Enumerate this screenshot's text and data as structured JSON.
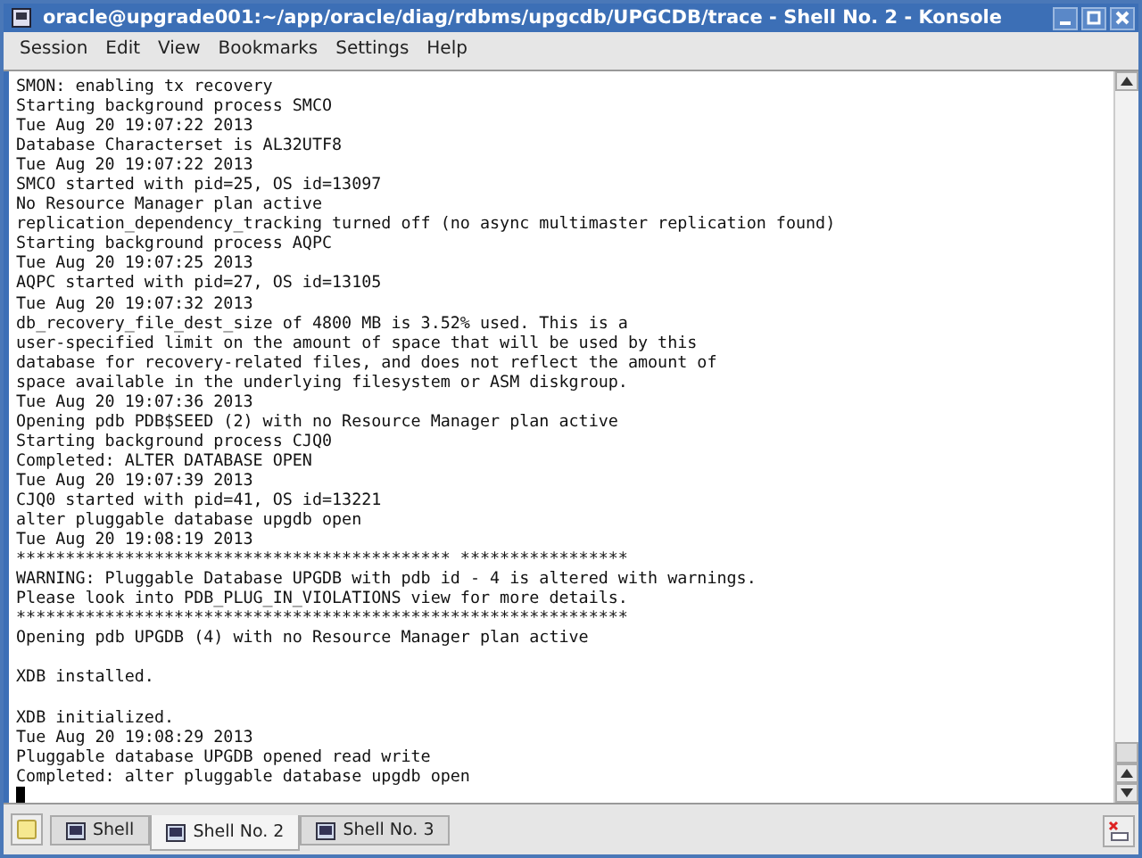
{
  "window": {
    "title": "oracle@upgrade001:~/app/oracle/diag/rdbms/upgcdb/UPGCDB/trace - Shell No. 2 - Konsole"
  },
  "menu": [
    "Session",
    "Edit",
    "View",
    "Bookmarks",
    "Settings",
    "Help"
  ],
  "terminal": {
    "lines": [
      {
        "kind": "text",
        "text": "SMON: enabling tx recovery"
      },
      {
        "kind": "text",
        "text": "Starting background process SMCO"
      },
      {
        "kind": "text",
        "text": "Tue Aug 20 19:07:22 2013"
      },
      {
        "kind": "text",
        "text": "Database Characterset is AL32UTF8"
      },
      {
        "kind": "text",
        "text": "Tue Aug 20 19:07:22 2013"
      },
      {
        "kind": "text",
        "text": "SMCO started with pid=25, OS id=13097"
      },
      {
        "kind": "text",
        "text": "No Resource Manager plan active"
      },
      {
        "kind": "text",
        "text": "replication_dependency_tracking turned off (no async multimaster replication found)"
      },
      {
        "kind": "text",
        "text": "Starting background process AQPC"
      },
      {
        "kind": "text",
        "text": "Tue Aug 20 19:07:25 2013"
      },
      {
        "kind": "text",
        "text": "AQPC started with pid=27, OS id=13105"
      },
      {
        "kind": "text",
        "text": "Tue Aug 20 19:07:32 2013"
      },
      {
        "kind": "text",
        "text": "db_recovery_file_dest_size of 4800 MB is 3.52% used. This is a"
      },
      {
        "kind": "text",
        "text": "user-specified limit on the amount of space that will be used by this"
      },
      {
        "kind": "text",
        "text": "database for recovery-related files, and does not reflect the amount of"
      },
      {
        "kind": "text",
        "text": "space available in the underlying filesystem or ASM diskgroup."
      },
      {
        "kind": "text",
        "text": "Tue Aug 20 19:07:36 2013"
      },
      {
        "kind": "text",
        "text": "Opening pdb PDB$SEED (2) with no Resource Manager plan active"
      },
      {
        "kind": "text",
        "text": "Starting background process CJQ0"
      },
      {
        "kind": "text",
        "text": "Completed: ALTER DATABASE OPEN"
      },
      {
        "kind": "text",
        "text": "Tue Aug 20 19:07:39 2013"
      },
      {
        "kind": "text",
        "text": "CJQ0 started with pid=41, OS id=13221"
      },
      {
        "kind": "text",
        "text": "alter pluggable database upgdb open"
      },
      {
        "kind": "text",
        "text": "Tue Aug 20 19:08:19 2013"
      },
      {
        "kind": "text",
        "text": "******************************************** *****************"
      },
      {
        "kind": "text",
        "text": "WARNING: Pluggable Database UPGDB with pdb id - 4 is altered with warnings."
      },
      {
        "kind": "text",
        "text": "Please look into PDB_PLUG_IN_VIOLATIONS view for more details."
      },
      {
        "kind": "text",
        "text": "**************************************************************"
      },
      {
        "kind": "text",
        "text": "Opening pdb UPGDB (4) with no Resource Manager plan active"
      },
      {
        "kind": "blank"
      },
      {
        "kind": "text",
        "text": "XDB installed."
      },
      {
        "kind": "blank"
      },
      {
        "kind": "text",
        "text": "XDB initialized."
      },
      {
        "kind": "text",
        "text": "Tue Aug 20 19:08:29 2013"
      },
      {
        "kind": "text",
        "text": "Pluggable database UPGDB opened read write"
      },
      {
        "kind": "text",
        "text": "Completed: alter pluggable database upgdb open"
      },
      {
        "kind": "cursor"
      }
    ]
  },
  "tabs": [
    {
      "label": "Shell",
      "selected": false
    },
    {
      "label": "Shell No. 2",
      "selected": true
    },
    {
      "label": "Shell No. 3",
      "selected": false
    }
  ]
}
